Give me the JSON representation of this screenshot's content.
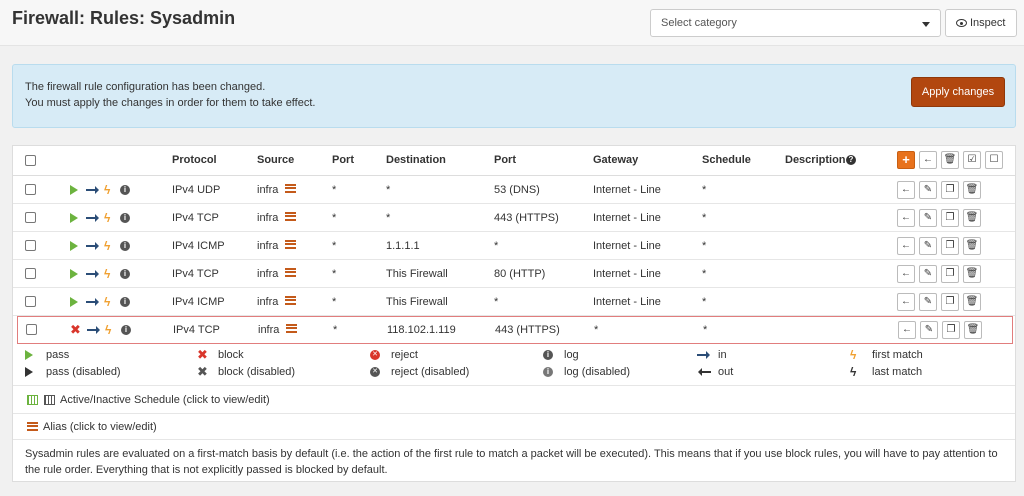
{
  "title": "Firewall: Rules: Sysadmin",
  "category_select": {
    "placeholder": "Select category"
  },
  "inspect_label": "Inspect",
  "alert": {
    "line1": "The firewall rule configuration has been changed.",
    "line2": "You must apply the changes in order for them to take effect.",
    "apply_label": "Apply changes"
  },
  "table": {
    "headers": {
      "protocol": "Protocol",
      "source": "Source",
      "port": "Port",
      "destination": "Destination",
      "dport": "Port",
      "gateway": "Gateway",
      "schedule": "Schedule",
      "description": "Description"
    },
    "rows": [
      {
        "action": "pass",
        "protocol": "IPv4 UDP",
        "source": "infra",
        "port": "*",
        "destination": "*",
        "dport": "53 (DNS)",
        "gateway": "Internet - Line",
        "schedule": "*"
      },
      {
        "action": "pass",
        "protocol": "IPv4 TCP",
        "source": "infra",
        "port": "*",
        "destination": "*",
        "dport": "443 (HTTPS)",
        "gateway": "Internet - Line",
        "schedule": "*"
      },
      {
        "action": "pass",
        "protocol": "IPv4 ICMP",
        "source": "infra",
        "port": "*",
        "destination": "1.1.1.1",
        "dport": "*",
        "gateway": "Internet - Line",
        "schedule": "*"
      },
      {
        "action": "pass",
        "protocol": "IPv4 TCP",
        "source": "infra",
        "port": "*",
        "destination": "This Firewall",
        "dport": "80 (HTTP)",
        "gateway": "Internet - Line",
        "schedule": "*"
      },
      {
        "action": "pass",
        "protocol": "IPv4 ICMP",
        "source": "infra",
        "port": "*",
        "destination": "This Firewall",
        "dport": "*",
        "gateway": "Internet - Line",
        "schedule": "*"
      },
      {
        "action": "block",
        "protocol": "IPv4 TCP",
        "source": "infra",
        "port": "*",
        "destination": "118.102.1.119",
        "dport": "443 (HTTPS)",
        "gateway": "*",
        "schedule": "*"
      }
    ]
  },
  "legend": {
    "pass": "pass",
    "pass_disabled": "pass (disabled)",
    "block": "block",
    "block_disabled": "block (disabled)",
    "reject": "reject",
    "reject_disabled": "reject (disabled)",
    "log": "log",
    "log_disabled": "log (disabled)",
    "in": "in",
    "out": "out",
    "first_match": "first match",
    "last_match": "last match"
  },
  "schedule_legend": "Active/Inactive Schedule (click to view/edit)",
  "alias_legend": "Alias (click to view/edit)",
  "footnote": "Sysadmin rules are evaluated on a first-match basis by default (i.e. the action of the first rule to match a packet will be executed). This means that if you use block rules, you will have to pay attention to the rule order. Everything that is not explicitly passed is blocked by default.",
  "colors": {
    "accent": "#b2470f",
    "pass": "#6cb33f",
    "block": "#d9362b",
    "alert_bg": "#d7ebf6"
  }
}
